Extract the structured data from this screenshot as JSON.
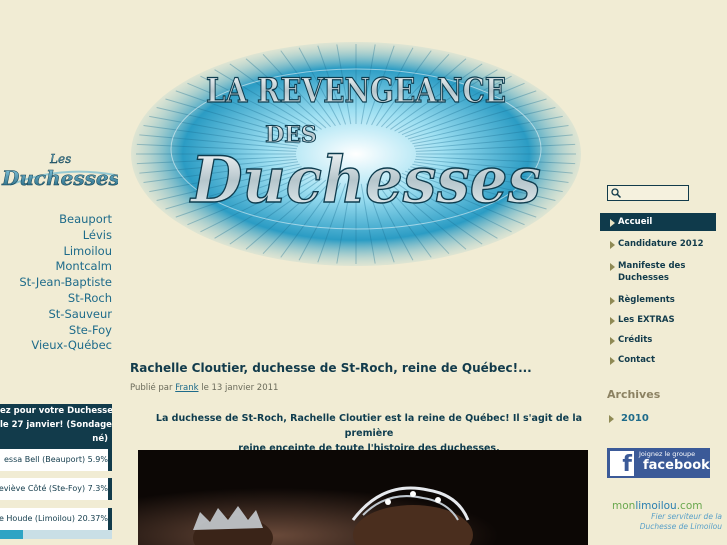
{
  "left_logo": {
    "line1": "Les",
    "line2": "Duchesses"
  },
  "districts": [
    "Beauport",
    "Lévis",
    "Limoilou",
    "Montcalm",
    "St-Jean-Baptiste",
    "St-Roch",
    "St-Sauveur",
    "Ste-Foy",
    "Vieux-Québec"
  ],
  "poll": {
    "title_lines": [
      "ez pour votre Duchesse",
      "le 27 janvier! (Sondage",
      "né)"
    ],
    "items": [
      {
        "label": "essa Bell (Beauport) 5.9%",
        "percent": 5.9
      },
      {
        "label": "eviève Côté (Ste-Foy) 7.3%",
        "percent": 7.3
      },
      {
        "label": "elle Houde (Limoilou) 20.37%",
        "percent": 20.37
      }
    ]
  },
  "banner": {
    "line1": "LA REVENGEANCE",
    "line2": "DES",
    "line3": "Duchesses"
  },
  "post": {
    "title": "Rachelle Cloutier, duchesse de St-Roch, reine de Québec!...",
    "meta_prefix": "Publié par",
    "author": "Frank",
    "meta_suffix": "le 13 janvier 2011",
    "body_line1": "La duchesse de St-Roch, Rachelle Cloutier est la reine de Québec! Il s'agit de la première",
    "body_line2": "reine enceinte de toute l'histoire des duchesses."
  },
  "search": {
    "placeholder": ""
  },
  "nav": [
    {
      "label": "Accueil",
      "active": true
    },
    {
      "label": "Candidature 2012"
    },
    {
      "label": "Manifeste des Duchesses"
    },
    {
      "label": "Règlements"
    },
    {
      "label": "Les EXTRAS"
    },
    {
      "label": "Crédits"
    },
    {
      "label": "Contact"
    }
  ],
  "archives": {
    "title": "Archives",
    "items": [
      "2010"
    ]
  },
  "facebook": {
    "join": "Joignez le groupe",
    "name": "facebook"
  },
  "monlimoilou": {
    "brand_a": "mon",
    "brand_b": "limoilou",
    "brand_c": ".com",
    "tag_line1": "Fier serviteur de la",
    "tag_line2": "Duchesse de Limoilou"
  },
  "colors": {
    "background": "#f1ecd4",
    "dark_teal": "#123b4b",
    "link_blue": "#1e6b8a",
    "banner_cyan": "#3fb3d6"
  }
}
